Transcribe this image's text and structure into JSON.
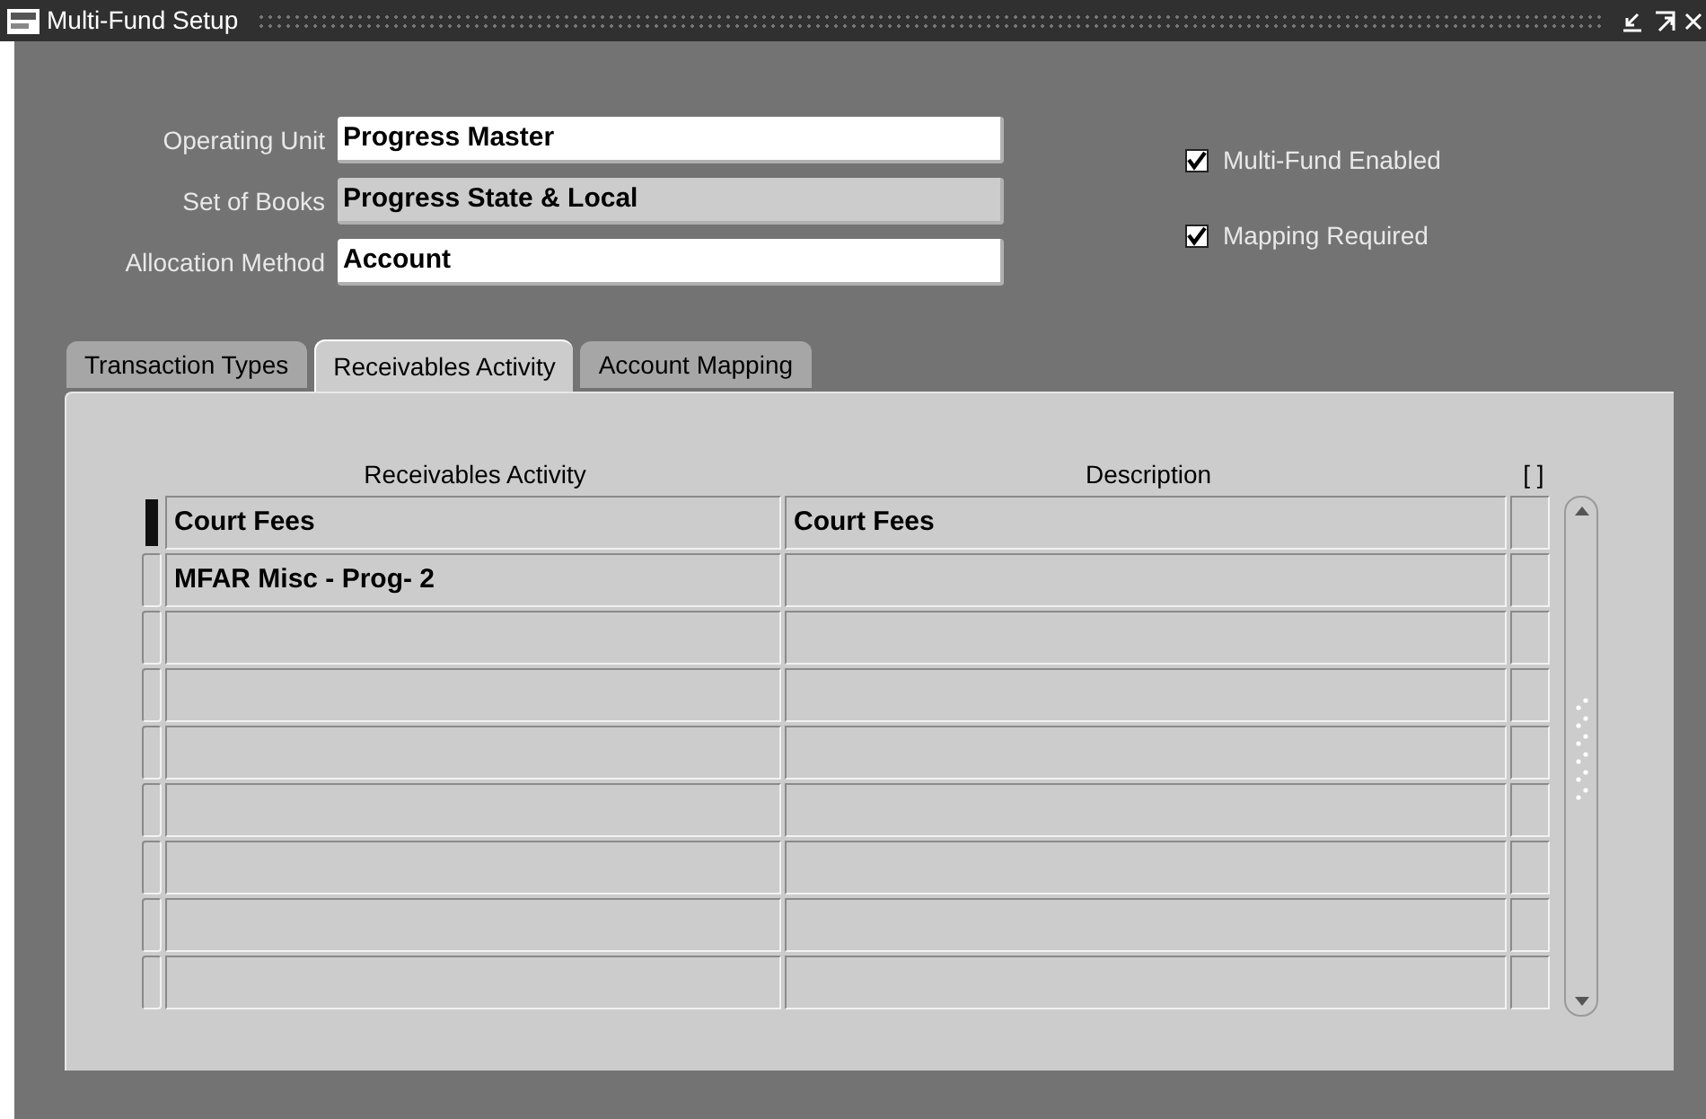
{
  "window": {
    "title": "Multi-Fund Setup"
  },
  "fields": [
    {
      "label": "Operating Unit",
      "value": "Progress Master",
      "disabled": false
    },
    {
      "label": "Set of Books",
      "value": "Progress State & Local",
      "disabled": true
    },
    {
      "label": "Allocation Method",
      "value": "Account",
      "disabled": false
    }
  ],
  "checkboxes": [
    {
      "label": "Multi-Fund Enabled",
      "checked": true
    },
    {
      "label": "Mapping Required",
      "checked": true
    }
  ],
  "tabs": [
    {
      "label": "Transaction Types",
      "selected": false
    },
    {
      "label": "Receivables Activity",
      "selected": true
    },
    {
      "label": "Account Mapping",
      "selected": false
    }
  ],
  "table": {
    "columns": [
      "Receivables Activity",
      "Description",
      "[ ]"
    ],
    "rows": [
      {
        "selected": true,
        "cells": [
          "Court Fees",
          "Court Fees"
        ]
      },
      {
        "selected": false,
        "cells": [
          "MFAR Misc - Prog- 2"
        ]
      }
    ]
  }
}
